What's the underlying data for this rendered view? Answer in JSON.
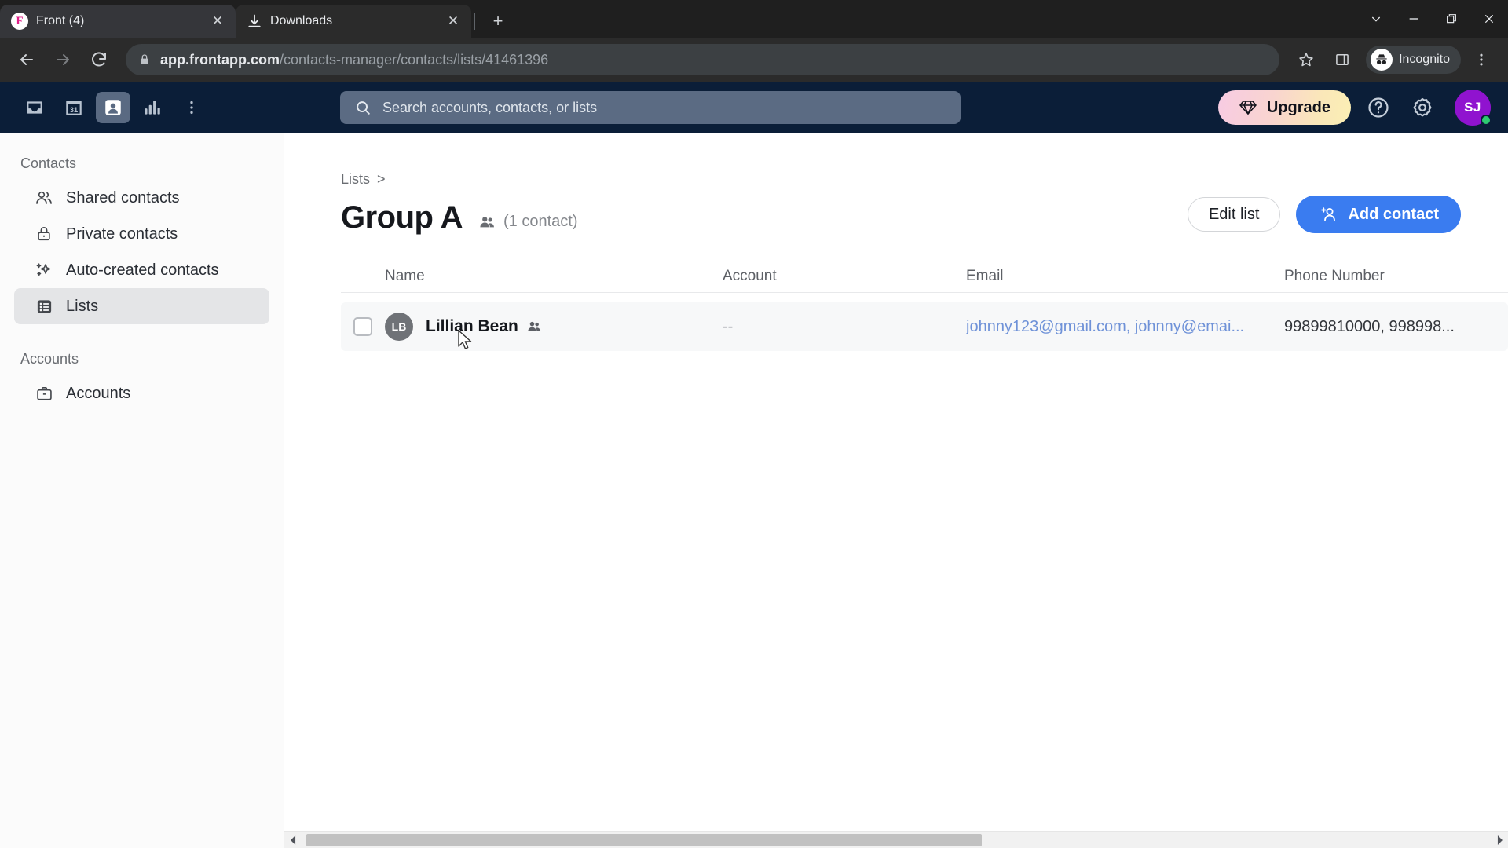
{
  "browser": {
    "tabs": [
      {
        "title": "Front (4)",
        "icon": "front-logo-icon",
        "active": true
      },
      {
        "title": "Downloads",
        "icon": "download-icon",
        "active": false
      }
    ],
    "new_tab_label": "+",
    "window_controls": [
      "tab-search-icon",
      "minimize-icon",
      "maximize-icon",
      "close-icon"
    ],
    "nav": {
      "back": "back-icon",
      "forward": "forward-icon",
      "reload": "reload-icon"
    },
    "omnibox": {
      "lock": "lock-icon",
      "domain": "app.frontapp.com",
      "path": "/contacts-manager/contacts/lists/41461396"
    },
    "actions": {
      "bookmark": "star-icon",
      "side_panel": "side-panel-icon",
      "profile_label": "Incognito",
      "menu": "kebab-menu-icon"
    }
  },
  "app_header": {
    "nav_icons": [
      {
        "name": "inbox-icon",
        "active": false
      },
      {
        "name": "calendar-icon",
        "active": false,
        "label": "31"
      },
      {
        "name": "contacts-icon",
        "active": true
      },
      {
        "name": "analytics-icon",
        "active": false
      },
      {
        "name": "more-icon",
        "active": false
      }
    ],
    "search_placeholder": "Search accounts, contacts, or lists",
    "upgrade_label": "Upgrade",
    "help_icon": "help-circle-icon",
    "settings_icon": "gear-icon",
    "avatar_initials": "SJ",
    "accent_blue": "#3a7cf0",
    "header_bg": "#0b1e38"
  },
  "sidebar": {
    "sections": [
      {
        "label": "Contacts",
        "items": [
          {
            "label": "Shared contacts",
            "icon": "people-icon",
            "selected": false
          },
          {
            "label": "Private contacts",
            "icon": "lock-icon",
            "selected": false
          },
          {
            "label": "Auto-created contacts",
            "icon": "sparkles-icon",
            "selected": false
          },
          {
            "label": "Lists",
            "icon": "list-icon",
            "selected": true
          }
        ]
      },
      {
        "label": "Accounts",
        "items": [
          {
            "label": "Accounts",
            "icon": "briefcase-icon",
            "selected": false
          }
        ]
      }
    ]
  },
  "main": {
    "breadcrumb": {
      "parent": "Lists",
      "separator": ">"
    },
    "title": "Group A",
    "title_icon": "people-icon",
    "contact_count_label": "(1 contact)",
    "edit_list_label": "Edit list",
    "add_contact_label": "Add contact",
    "add_contact_icon": "add-person-icon",
    "table": {
      "columns": [
        "Name",
        "Account",
        "Email",
        "Phone Number"
      ],
      "rows": [
        {
          "checked": false,
          "avatar_initials": "LB",
          "name": "Lillian Bean",
          "shared_icon": "people-icon",
          "account": "--",
          "email": "johnny123@gmail.com, johnny@emai...",
          "phone": "99899810000, 998998..."
        }
      ]
    }
  },
  "scrollbar": {
    "left_arrow": "chevron-left-icon",
    "right_arrow": "chevron-right-icon"
  }
}
